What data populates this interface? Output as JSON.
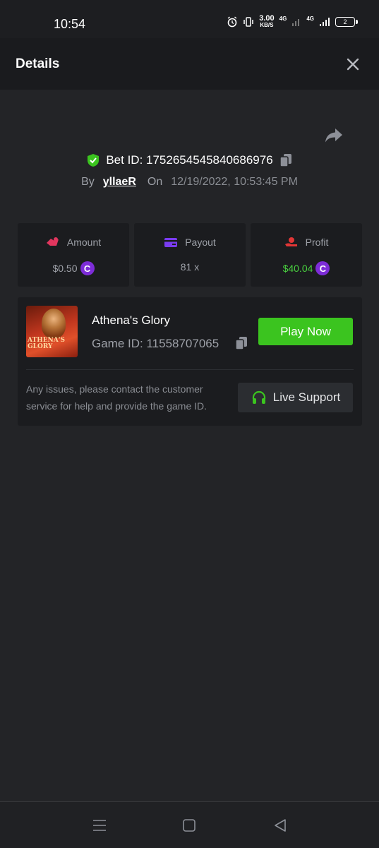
{
  "status_bar": {
    "time": "10:54",
    "speed_value": "3.00",
    "speed_unit": "KB/S",
    "network_1": "4G",
    "network_2": "4G",
    "battery": "2",
    "icons": [
      "alarm-icon",
      "vibrate-icon",
      "signal-icon",
      "battery-icon"
    ]
  },
  "header": {
    "title": "Details",
    "close_icon": "close-icon"
  },
  "bet": {
    "label": "Bet ID: 1752654545840686976",
    "by_label": "By",
    "user": "yllaeR",
    "on_label": "On",
    "date": "12/19/2022, 10:53:45 PM",
    "shield_color": "#3bc41f"
  },
  "stats": {
    "amount": {
      "label": "Amount",
      "value": "$0.50",
      "icon": "hand-coin-icon",
      "icon_color": "#e2365e"
    },
    "payout": {
      "label": "Payout",
      "value": "81 x",
      "icon": "card-icon",
      "icon_color": "#7a3cf0"
    },
    "profit": {
      "label": "Profit",
      "value": "$40.04",
      "icon": "money-hand-icon",
      "icon_color": "#e23636",
      "value_color": "#49d23f"
    },
    "coin_symbol": "C"
  },
  "game": {
    "thumb_text": "ATHENA'S GLORY",
    "name": "Athena's Glory",
    "id_label": "Game ID: 11558707065",
    "play_label": "Play Now",
    "help_text": "Any issues, please contact the customer service for help and provide the game ID.",
    "support_label": "Live Support",
    "accent": "#3bc41f"
  },
  "navbar": {
    "items": [
      "menu-icon",
      "home-icon",
      "back-icon"
    ]
  }
}
